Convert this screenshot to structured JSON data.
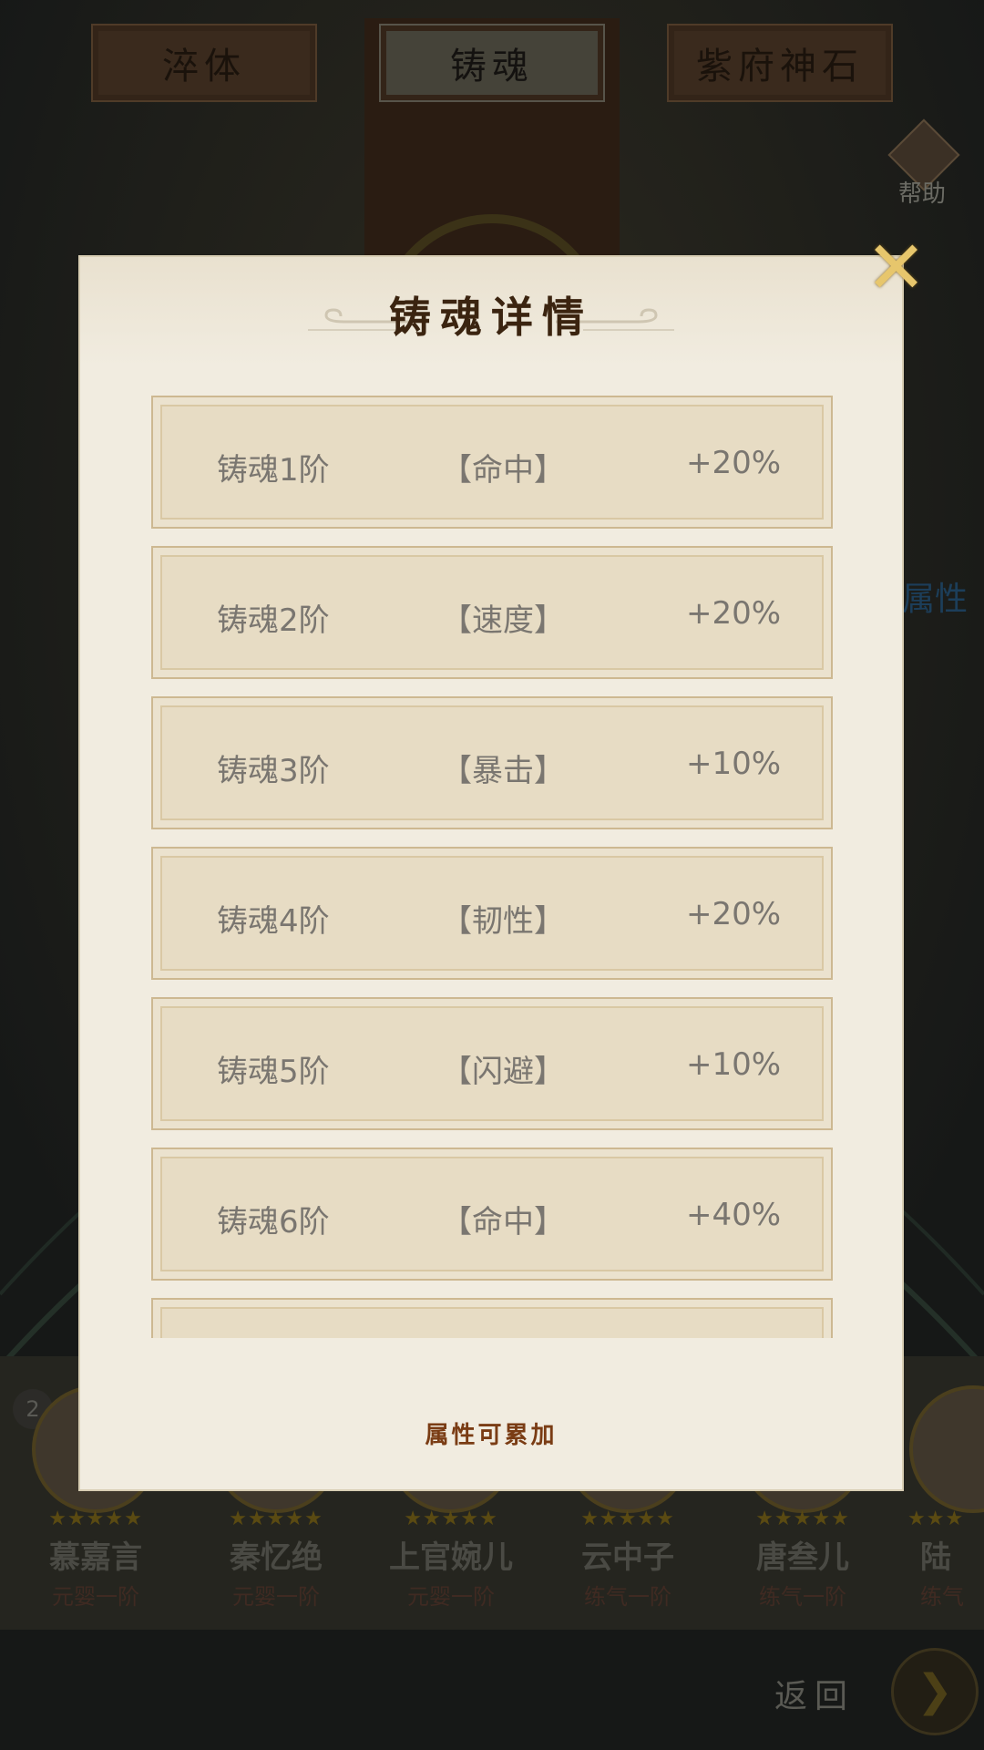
{
  "top_tabs": [
    {
      "label": "淬体",
      "active": false
    },
    {
      "label": "铸魂",
      "active": true
    },
    {
      "label": "紫府神石",
      "active": false
    }
  ],
  "help_label": "帮助",
  "side_label": "属性",
  "modal": {
    "title": "铸魂详情",
    "rows": [
      {
        "level": "铸魂1阶",
        "attribute": "【命中】",
        "bonus": "+20%"
      },
      {
        "level": "铸魂2阶",
        "attribute": "【速度】",
        "bonus": "+20%"
      },
      {
        "level": "铸魂3阶",
        "attribute": "【暴击】",
        "bonus": "+10%"
      },
      {
        "level": "铸魂4阶",
        "attribute": "【韧性】",
        "bonus": "+20%"
      },
      {
        "level": "铸魂5阶",
        "attribute": "【闪避】",
        "bonus": "+10%"
      },
      {
        "level": "铸魂6阶",
        "attribute": "【命中】",
        "bonus": "+40%"
      }
    ],
    "footer_note": "属性可累加",
    "close_icon": "close-x-icon"
  },
  "heroes": [
    {
      "name": "慕嘉言",
      "rank": "元婴一阶",
      "stars": "★★★★★"
    },
    {
      "name": "秦忆绝",
      "rank": "元婴一阶",
      "stars": "★★★★★"
    },
    {
      "name": "上官婉儿",
      "rank": "元婴一阶",
      "stars": "★★★★★"
    },
    {
      "name": "云中子",
      "rank": "练气一阶",
      "stars": "★★★★★"
    },
    {
      "name": "唐叁儿",
      "rank": "练气一阶",
      "stars": "★★★★★"
    },
    {
      "name": "陆",
      "rank": "练气",
      "stars": "★★★"
    }
  ],
  "hero_count_badge": "2",
  "return_label": "返回",
  "colors": {
    "modal_bg": "#f1ece0",
    "row_bg": "#e7dcc4",
    "title": "#3b2410",
    "footer": "#7a3c14"
  }
}
